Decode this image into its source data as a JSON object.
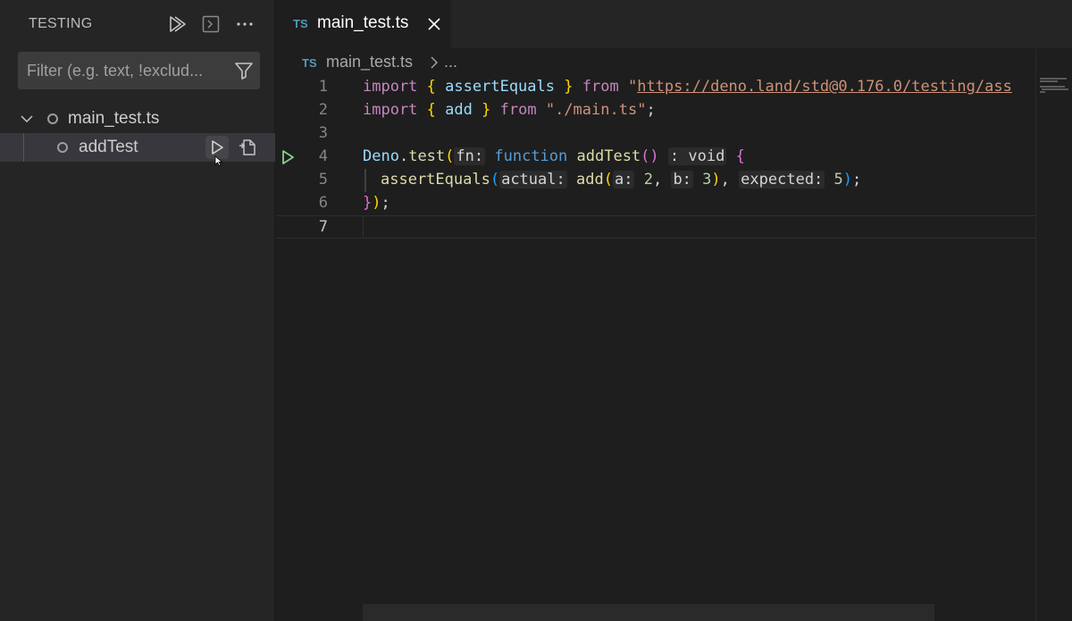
{
  "sidebar": {
    "title": "TESTING",
    "actions": {
      "run_all_icon": "run-all-icon",
      "debug_icon": "terminal-icon",
      "more_icon": "ellipsis-icon"
    },
    "filter": {
      "placeholder": "Filter (e.g. text, !exclud...",
      "value": ""
    },
    "tree": {
      "root_label": "main_test.ts",
      "child_label": "addTest"
    }
  },
  "editor": {
    "tab": {
      "badge": "TS",
      "label": "main_test.ts"
    },
    "breadcrumb": {
      "badge": "TS",
      "file": "main_test.ts",
      "more": "..."
    },
    "line_numbers": [
      "1",
      "2",
      "3",
      "4",
      "5",
      "6",
      "7"
    ],
    "code": {
      "l1": {
        "import": "import",
        "ob": "{",
        "name": "assertEquals",
        "cb": "}",
        "from": "from",
        "q": "\"",
        "url": "https://deno.land/std@0.176.0/testing/ass"
      },
      "l2": {
        "import": "import",
        "ob": "{",
        "name": "add",
        "cb": "}",
        "from": "from",
        "str": "\"./main.ts\"",
        "end": ";"
      },
      "l4": {
        "obj": "Deno",
        "dot": ".",
        "method": "test",
        "po": "(",
        "hint_fn": "fn:",
        "function": "function",
        "name": "addTest",
        "parens": "()",
        "hint_ret": ": void",
        "ob": "{"
      },
      "l5": {
        "fn": "assertEquals",
        "po": "(",
        "hint_actual": "actual:",
        "add": "add",
        "po2": "(",
        "hint_a": "a:",
        "a": "2",
        "comma": ",",
        "hint_b": "b:",
        "b": "3",
        "pc2": ")",
        "comma2": ",",
        "hint_expected": "expected:",
        "expected": "5",
        "pc": ")",
        "end": ";"
      },
      "l6": {
        "cb": "}",
        "pc": ")",
        "end": ";"
      }
    }
  },
  "colors": {
    "accent_run": "#89d185",
    "ts_badge": "#519aba"
  }
}
